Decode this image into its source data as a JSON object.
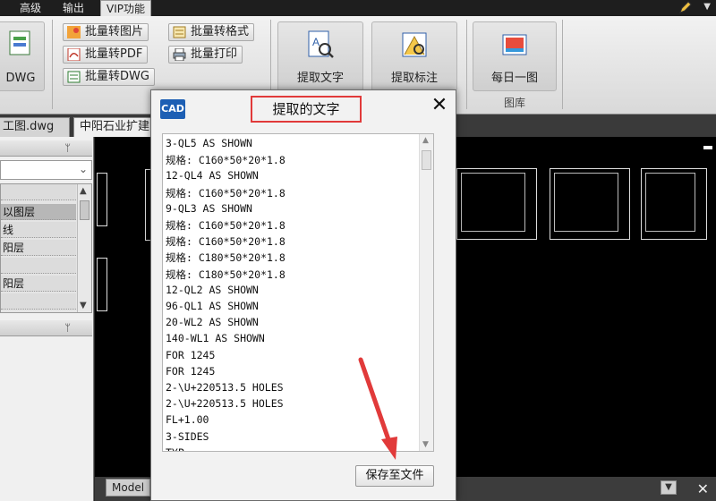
{
  "menubar": {
    "items": [
      "高级",
      "输出",
      "VIP功能"
    ]
  },
  "ribbon": {
    "big_buttons": {
      "dwg": "DWG",
      "extract_text": "提取文字",
      "extract_dim": "提取标注",
      "daily_image": "每日一图"
    },
    "small_buttons": {
      "batch_image": "批量转图片",
      "batch_pdf": "批量转PDF",
      "batch_dwg": "批量转DWG",
      "batch_format": "批量转格式",
      "batch_print": "批量打印"
    },
    "group_labels": {
      "gallery": "图库"
    }
  },
  "doc_tabs": [
    "工图.dwg",
    "中阳石业扩建"
  ],
  "left_panel": {
    "layers": [
      "以图层",
      "线",
      "阳层",
      "",
      "阳层"
    ]
  },
  "canvas": {
    "model_tab": "Model"
  },
  "dialog": {
    "icon_text": "CAD",
    "title": "提取的文字",
    "lines": [
      "3-QL5 AS SHOWN",
      "规格: C160*50*20*1.8",
      "12-QL4 AS SHOWN",
      "规格: C160*50*20*1.8",
      "9-QL3 AS SHOWN",
      "规格: C160*50*20*1.8",
      "规格: C160*50*20*1.8",
      "规格: C180*50*20*1.8",
      "规格: C180*50*20*1.8",
      "12-QL2 AS SHOWN",
      "96-QL1 AS SHOWN",
      "20-WL2 AS SHOWN",
      "140-WL1 AS SHOWN",
      "FOR 1245",
      "FOR 1245",
      "2-\\U+220513.5 HOLES",
      "2-\\U+220513.5 HOLES",
      "FL+1.00",
      "3-SIDES",
      "TYP"
    ],
    "save_button": "保存至文件"
  },
  "colors": {
    "highlight_red": "#e13a3a",
    "cad_blue": "#1d5fb4"
  }
}
